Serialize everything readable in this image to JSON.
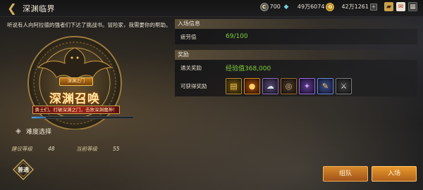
{
  "header": {
    "back_icon": "back-arrow-icon",
    "title": "深渊临界"
  },
  "currencies": [
    {
      "icon": "c-coin-icon",
      "value": "700"
    },
    {
      "icon": "diamond-icon",
      "value": "49万6074"
    },
    {
      "icon": "gold-coin-icon",
      "value": "42万1261"
    }
  ],
  "left": {
    "intro": "听说有人向阿拉德的强者们下达了挑战书。冒险家，我需要你的帮助。",
    "emblem_level": "深渊之门",
    "emblem_title": "深渊召唤",
    "emblem_sub": "勇士们，打破深渊之门，击败深渊魔神！",
    "progress": 0.14,
    "difficulty_label": "难度选择",
    "recommended_level_label": "建议等级",
    "recommended_level": "48",
    "current_level_label": "当前等级",
    "current_level": "55",
    "difficulty_badge": "普通"
  },
  "entry": {
    "section_title": "入场信息",
    "fatigue_label": "疲劳值",
    "fatigue_value": "69/100"
  },
  "rewards": {
    "section_title": "奖励",
    "clear_label": "通关奖励",
    "clear_value": "经验值368,000",
    "possible_label": "可获得奖励",
    "items": [
      {
        "icon": "gold-stack-icon",
        "color": "gold"
      },
      {
        "icon": "orange-orb-icon",
        "color": "orange"
      },
      {
        "icon": "silver-material-icon",
        "color": "silver"
      },
      {
        "icon": "dark-box-icon",
        "color": "dark"
      },
      {
        "icon": "purple-crystal-icon",
        "color": "purple"
      },
      {
        "icon": "blue-ticket-icon",
        "color": "blue"
      },
      {
        "icon": "sword-icon",
        "color": "grey"
      }
    ]
  },
  "buttons": {
    "team": "组队",
    "enter": "入场"
  }
}
